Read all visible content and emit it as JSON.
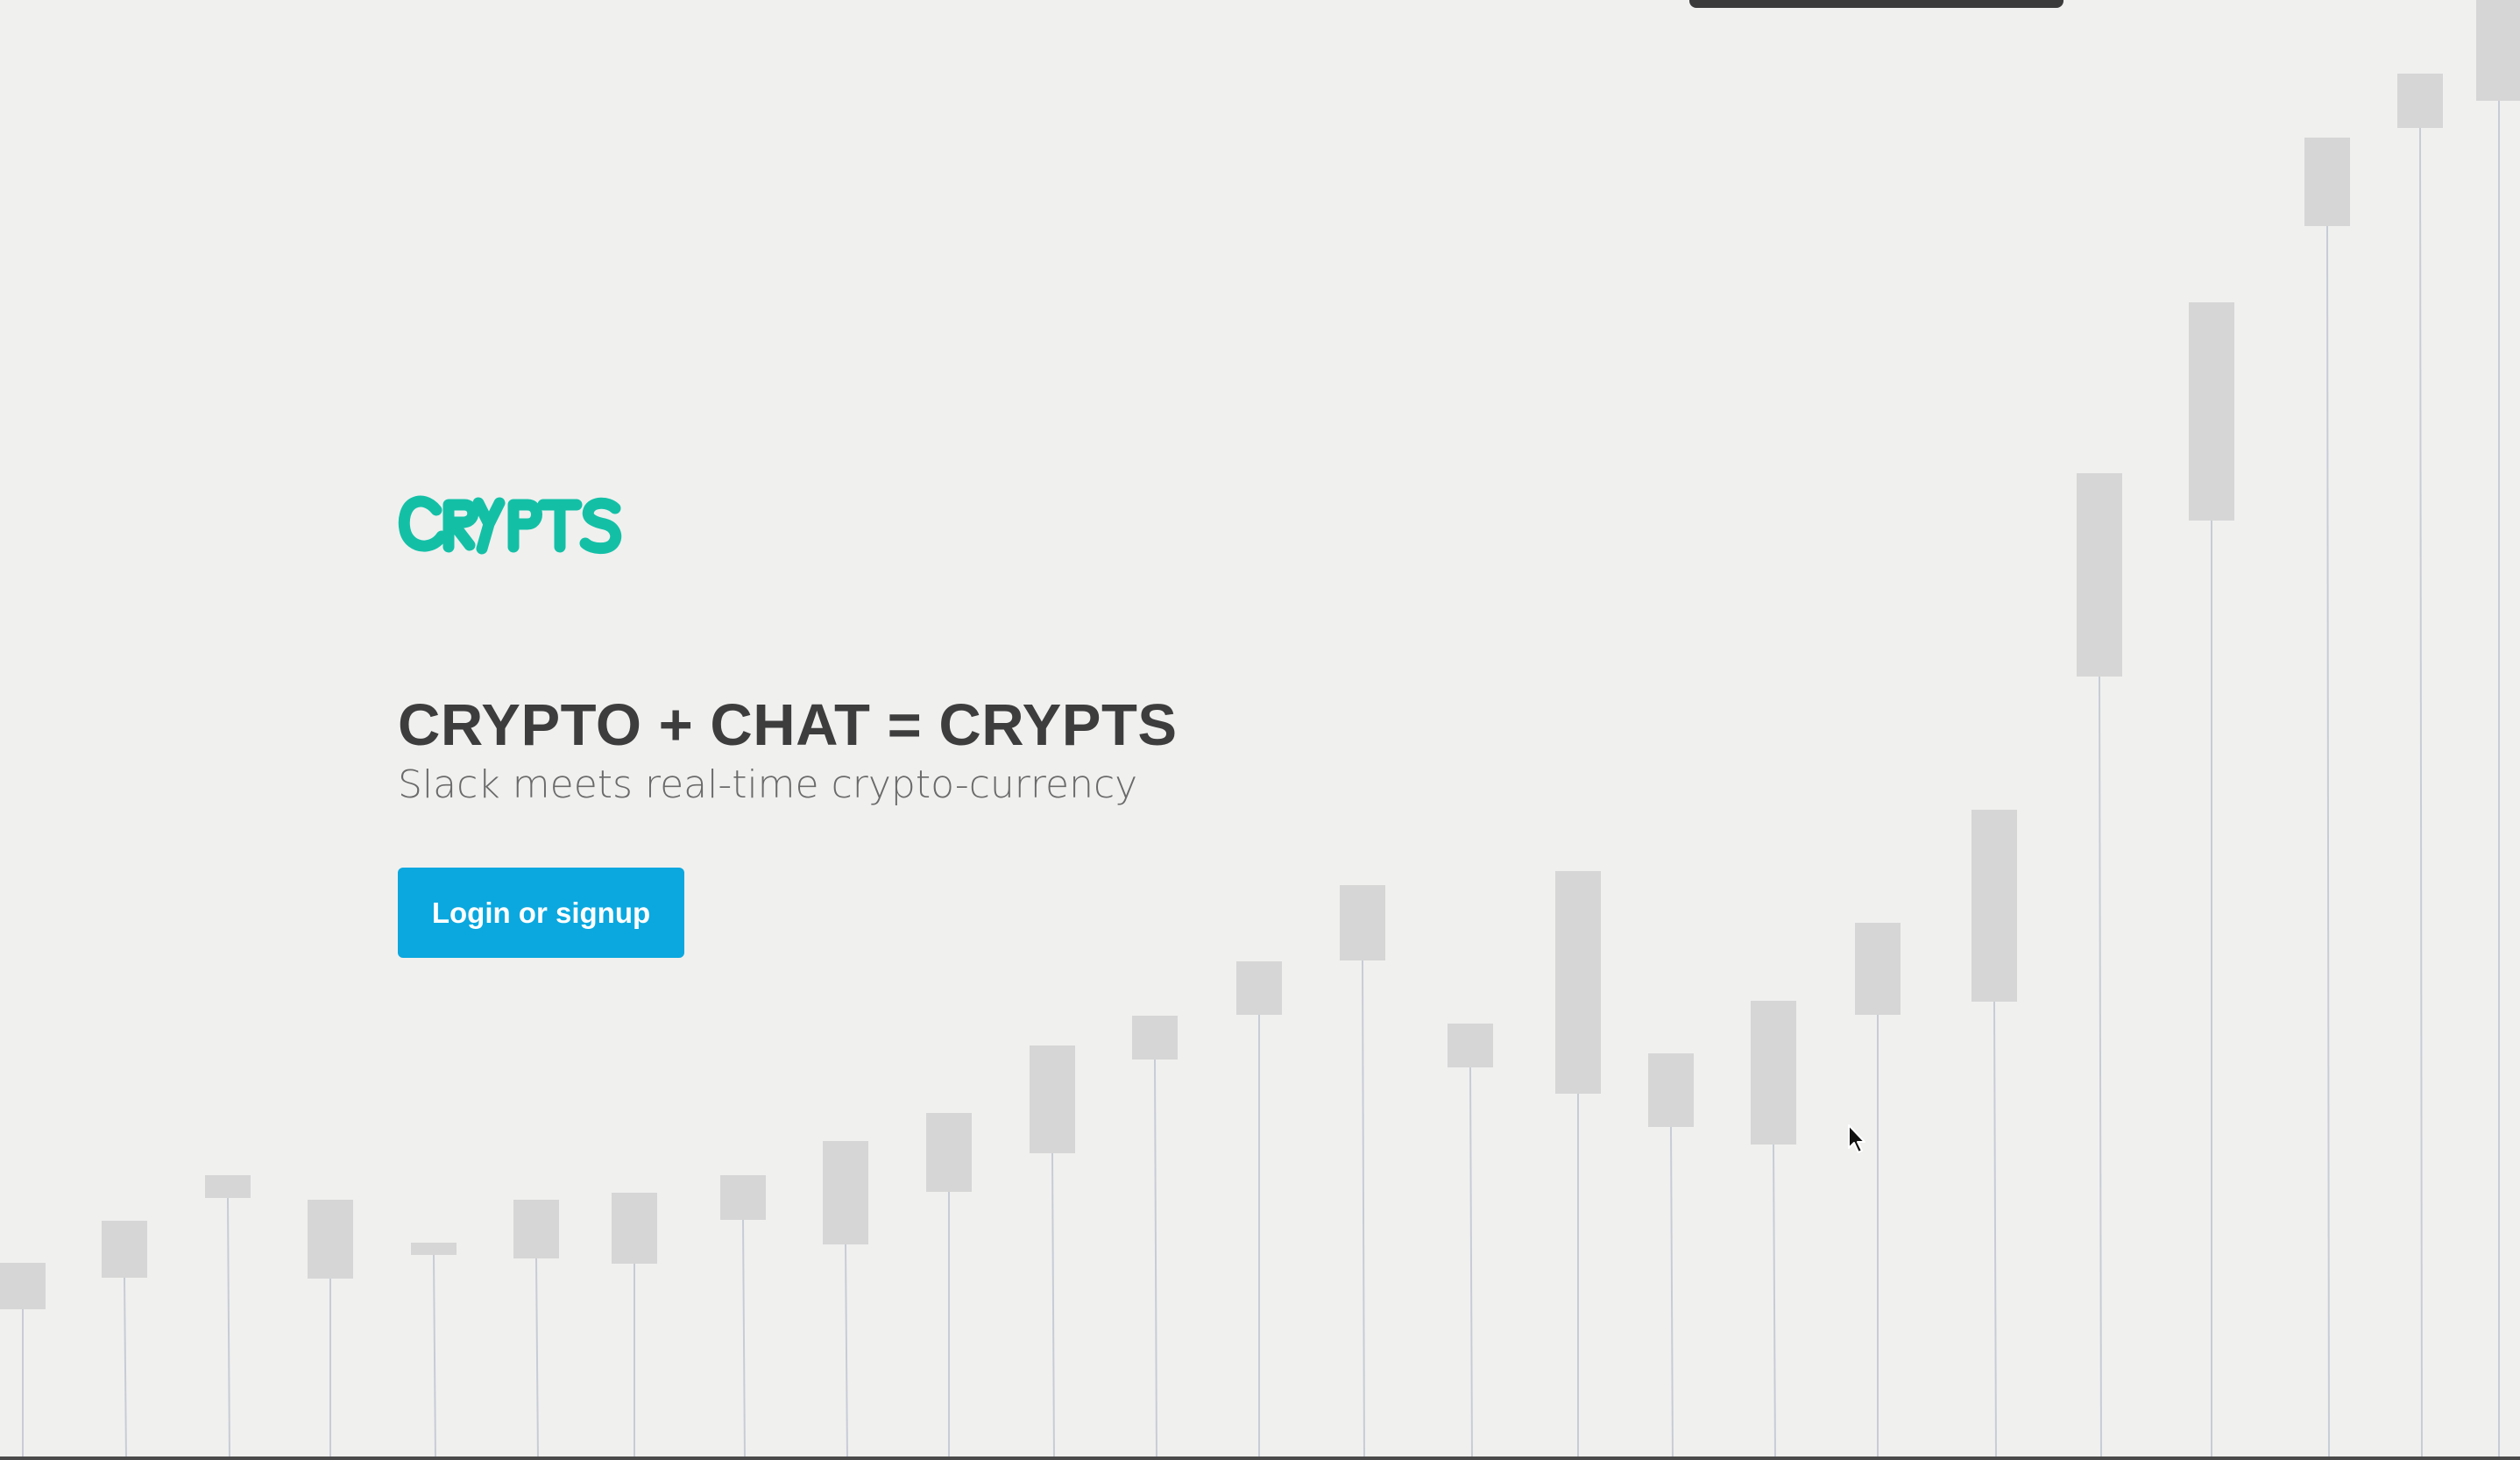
{
  "brand": {
    "logo_text": "CRYPTS",
    "accent_color": "#13c0a6"
  },
  "hero": {
    "headline": "CRYPTO + CHAT = CRYPTS",
    "tagline": "Slack meets real-time crypto-currency"
  },
  "cta": {
    "label": "Login or signup",
    "color": "#0aa8df"
  },
  "background_chart": {
    "type": "candlestick",
    "candle_color": "#d6d6d6",
    "wick_color": "#c7ccd6"
  },
  "icons": {
    "pointer": "mouse-pointer-icon"
  }
}
